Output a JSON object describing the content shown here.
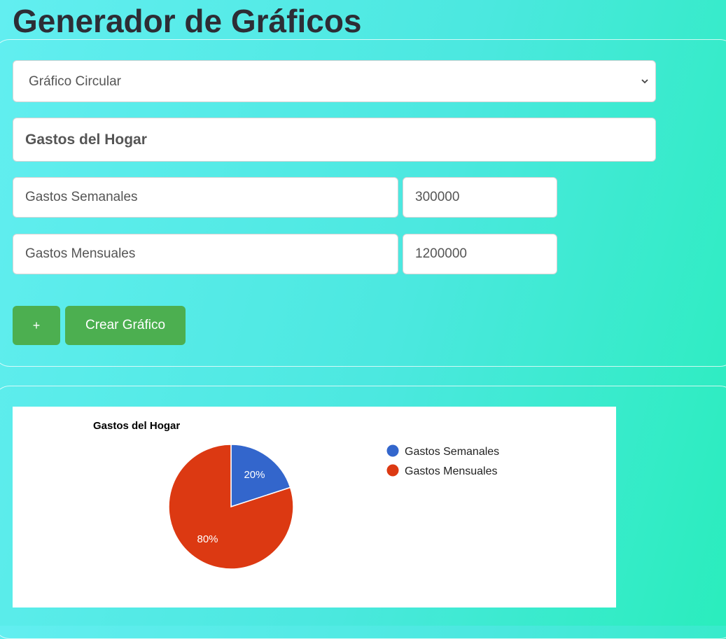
{
  "header": {
    "title": "Generador de Gráficos"
  },
  "form": {
    "chart_type": {
      "selected": "Gráfico Circular"
    },
    "chart_title_value": "Gastos del Hogar",
    "rows": [
      {
        "label": "Gastos Semanales",
        "value": "300000"
      },
      {
        "label": "Gastos Mensuales",
        "value": "1200000"
      }
    ],
    "add_button_label": "+",
    "create_button_label": "Crear Gráfico"
  },
  "chart_data": {
    "type": "pie",
    "title": "Gastos del Hogar",
    "categories": [
      "Gastos Semanales",
      "Gastos Mensuales"
    ],
    "values": [
      300000,
      1200000
    ],
    "slice_labels": [
      "20%",
      "80%"
    ],
    "colors": [
      "#3366cc",
      "#dc3912"
    ],
    "legend_position": "right"
  }
}
